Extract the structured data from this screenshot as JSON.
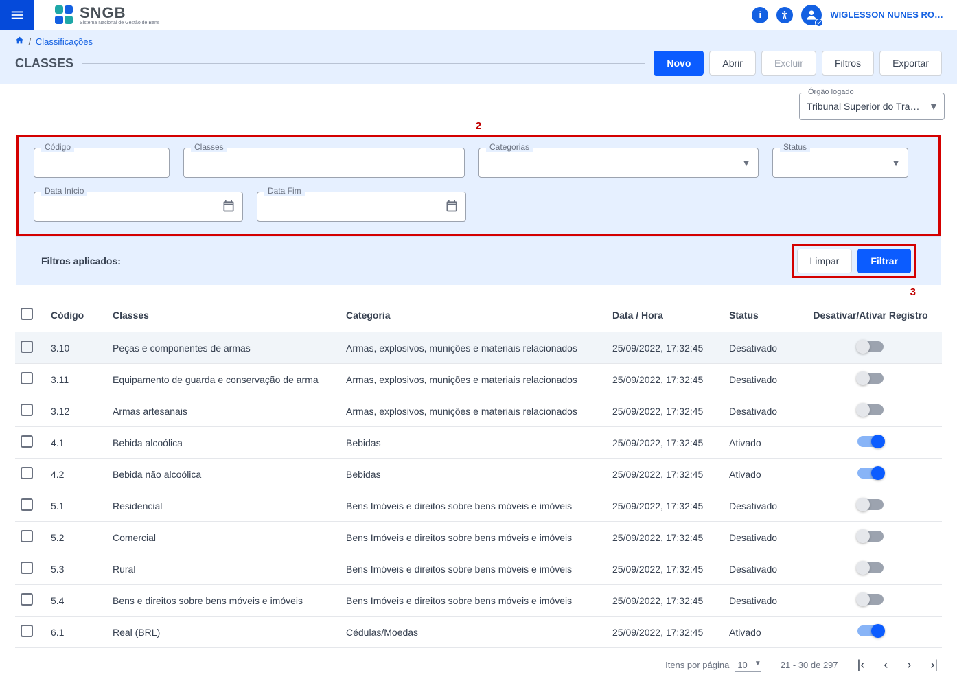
{
  "brand": {
    "name": "SNGB",
    "subtitle": "Sistema Nacional de Gestão de Bens"
  },
  "user": {
    "name": "WIGLESSON NUNES RO…"
  },
  "breadcrumb": {
    "item": "Classificações"
  },
  "page_title": "CLASSES",
  "actions": {
    "novo": "Novo",
    "abrir": "Abrir",
    "excluir": "Excluir",
    "filtros": "Filtros",
    "exportar": "Exportar"
  },
  "org": {
    "label": "Órgão logado",
    "value": "Tribunal Superior do Tra…"
  },
  "annotations": {
    "a2": "2",
    "a3": "3"
  },
  "filters": {
    "codigo": {
      "label": "Código",
      "value": ""
    },
    "classes": {
      "label": "Classes",
      "value": ""
    },
    "categorias": {
      "label": "Categorias",
      "value": ""
    },
    "status": {
      "label": "Status",
      "value": ""
    },
    "data_inicio": {
      "label": "Data Início",
      "value": ""
    },
    "data_fim": {
      "label": "Data Fim",
      "value": ""
    }
  },
  "applied": {
    "label": "Filtros aplicados:",
    "limpar": "Limpar",
    "filtrar": "Filtrar"
  },
  "table": {
    "headers": {
      "codigo": "Código",
      "classes": "Classes",
      "categoria": "Categoria",
      "data": "Data / Hora",
      "status": "Status",
      "toggle": "Desativar/Ativar Registro"
    },
    "rows": [
      {
        "codigo": "3.10",
        "classe": "Peças e componentes de armas",
        "categoria": "Armas, explosivos, munições e materiais relacionados",
        "data": "25/09/2022, 17:32:45",
        "status": "Desativado",
        "active": false
      },
      {
        "codigo": "3.11",
        "classe": "Equipamento de guarda e conservação de arma",
        "categoria": "Armas, explosivos, munições e materiais relacionados",
        "data": "25/09/2022, 17:32:45",
        "status": "Desativado",
        "active": false
      },
      {
        "codigo": "3.12",
        "classe": "Armas artesanais",
        "categoria": "Armas, explosivos, munições e materiais relacionados",
        "data": "25/09/2022, 17:32:45",
        "status": "Desativado",
        "active": false
      },
      {
        "codigo": "4.1",
        "classe": "Bebida alcoólica",
        "categoria": "Bebidas",
        "data": "25/09/2022, 17:32:45",
        "status": "Ativado",
        "active": true
      },
      {
        "codigo": "4.2",
        "classe": "Bebida não alcoólica",
        "categoria": "Bebidas",
        "data": "25/09/2022, 17:32:45",
        "status": "Ativado",
        "active": true
      },
      {
        "codigo": "5.1",
        "classe": "Residencial",
        "categoria": "Bens Imóveis e direitos sobre bens móveis e imóveis",
        "data": "25/09/2022, 17:32:45",
        "status": "Desativado",
        "active": false
      },
      {
        "codigo": "5.2",
        "classe": "Comercial",
        "categoria": "Bens Imóveis e direitos sobre bens móveis e imóveis",
        "data": "25/09/2022, 17:32:45",
        "status": "Desativado",
        "active": false
      },
      {
        "codigo": "5.3",
        "classe": "Rural",
        "categoria": "Bens Imóveis e direitos sobre bens móveis e imóveis",
        "data": "25/09/2022, 17:32:45",
        "status": "Desativado",
        "active": false
      },
      {
        "codigo": "5.4",
        "classe": "Bens e direitos sobre bens móveis e imóveis",
        "categoria": "Bens Imóveis e direitos sobre bens móveis e imóveis",
        "data": "25/09/2022, 17:32:45",
        "status": "Desativado",
        "active": false
      },
      {
        "codigo": "6.1",
        "classe": "Real (BRL)",
        "categoria": "Cédulas/Moedas",
        "data": "25/09/2022, 17:32:45",
        "status": "Ativado",
        "active": true
      }
    ]
  },
  "pager": {
    "ipp_label": "Itens por página",
    "ipp_value": "10",
    "range": "21 - 30 de 297"
  }
}
